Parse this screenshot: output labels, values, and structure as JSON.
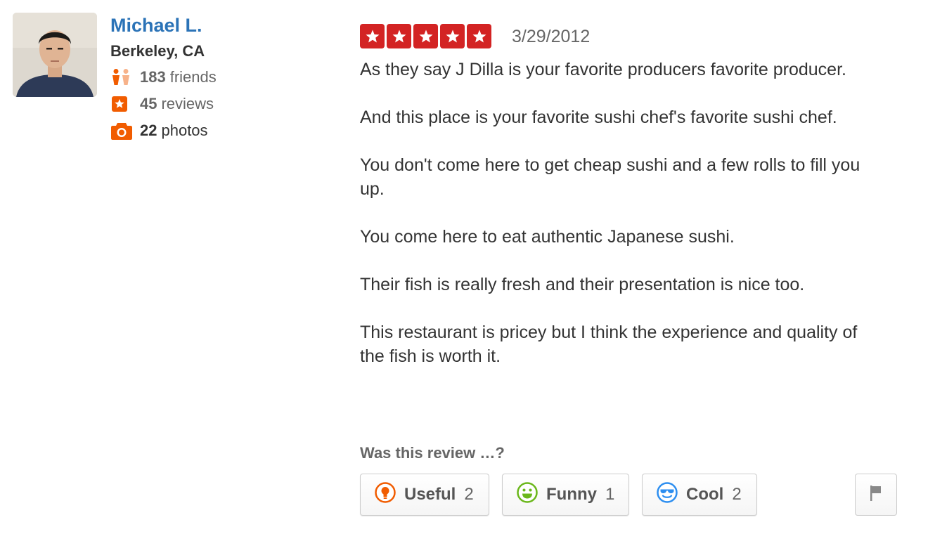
{
  "user": {
    "name": "Michael L.",
    "location": "Berkeley, CA",
    "friends": {
      "count": "183",
      "label": "friends",
      "icon": "friends-icon"
    },
    "reviews": {
      "count": "45",
      "label": "reviews",
      "icon": "star-badge-icon"
    },
    "photos": {
      "count": "22",
      "label": "photos",
      "icon": "camera-icon"
    }
  },
  "review": {
    "rating": 5,
    "rating_max": 5,
    "date": "3/29/2012",
    "paragraphs": [
      "As they say J Dilla is your favorite producers favorite producer.",
      "And this place is your favorite sushi chef's favorite sushi chef.",
      "You don't come here to get cheap sushi and a few rolls to fill you up.",
      "You come here to eat authentic Japanese sushi.",
      "Their fish is really fresh and their presentation is nice too.",
      "This restaurant is pricey but I think the experience and quality of the fish is worth it."
    ]
  },
  "votes": {
    "prompt": "Was this review …?",
    "useful": {
      "label": "Useful",
      "count": "2",
      "icon": "lightbulb-icon"
    },
    "funny": {
      "label": "Funny",
      "count": "1",
      "icon": "smiley-icon"
    },
    "cool": {
      "label": "Cool",
      "count": "2",
      "icon": "sunglasses-icon"
    },
    "flag_icon": "flag-icon"
  },
  "colors": {
    "link_blue": "#2b73b7",
    "star_red": "#d32323",
    "accent_orange": "#f15c00",
    "funny_green": "#6bb71b",
    "cool_blue": "#2c8ef0"
  }
}
